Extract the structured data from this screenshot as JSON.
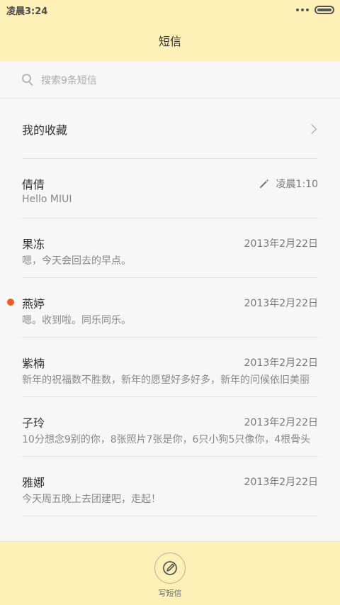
{
  "status_bar": {
    "time": "凌晨3:24"
  },
  "header": {
    "title": "短信"
  },
  "search": {
    "placeholder": "搜索9条短信"
  },
  "favorites": {
    "label": "我的收藏"
  },
  "conversations": [
    {
      "name": "倩倩",
      "preview": "Hello MIUI",
      "date": "凌晨1:10",
      "draft": true,
      "unread": false
    },
    {
      "name": "果冻",
      "preview": "嗯，今天会回去的早点。",
      "date": "2013年2月22日",
      "draft": false,
      "unread": false
    },
    {
      "name": "燕婷",
      "preview": "嗯。收到啦。同乐同乐。",
      "date": "2013年2月22日",
      "draft": false,
      "unread": true
    },
    {
      "name": "紫楠",
      "preview": "新年的祝福数不胜数，新年的愿望好多好多，新年的问候依旧美丽",
      "date": "2013年2月22日",
      "draft": false,
      "unread": false
    },
    {
      "name": "子玲",
      "preview": "10分想念9别的你，8张照片7张是你，6只小狗5只像你，4根骨头",
      "date": "2013年2月22日",
      "draft": false,
      "unread": false
    },
    {
      "name": "雅娜",
      "preview": "今天周五晚上去团建吧，走起！",
      "date": "2013年2月22日",
      "draft": false,
      "unread": false
    }
  ],
  "bottom": {
    "compose_label": "写短信"
  },
  "colors": {
    "header_bg": "#fdf1b8",
    "unread_dot": "#f55a1f",
    "background": "#f7f7f7"
  }
}
